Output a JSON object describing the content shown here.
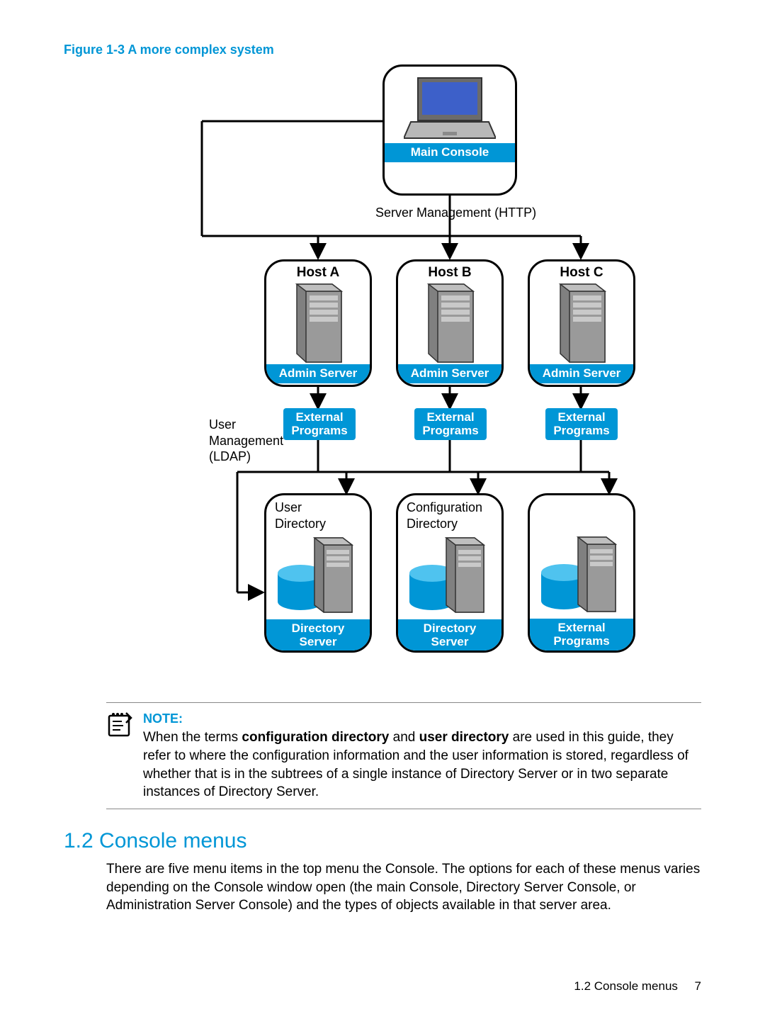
{
  "figure_caption": "Figure 1-3 A more complex system",
  "diagram": {
    "main_console": "Main Console",
    "server_mgmt": "Server Management (HTTP)",
    "hosts": {
      "a": {
        "title": "Host A",
        "admin": "Admin Server"
      },
      "b": {
        "title": "Host B",
        "admin": "Admin Server"
      },
      "c": {
        "title": "Host C",
        "admin": "Admin Server"
      }
    },
    "ext_programs": "External\nPrograms",
    "user_mgmt": "User\nManagement\n(LDAP)",
    "user_dir": "User\nDirectory",
    "config_dir": "Configuration\nDirectory",
    "dir_server": "Directory\nServer"
  },
  "note": {
    "title": "NOTE:",
    "text_parts": [
      "When the terms ",
      "configuration directory",
      " and ",
      "user directory",
      " are used in this guide, they refer to where the configuration information and the user information is stored, regardless of whether that is in the subtrees of a single instance of Directory Server or in two separate instances of Directory Server."
    ]
  },
  "section": {
    "heading": "1.2 Console menus",
    "body": "There are five menu items in the top menu the Console. The options for each of these menus varies depending on the Console window open (the main Console, Directory Server Console, or Administration Server Console) and the types of objects available in that server area."
  },
  "footer": {
    "text": "1.2 Console menus",
    "page": "7"
  }
}
